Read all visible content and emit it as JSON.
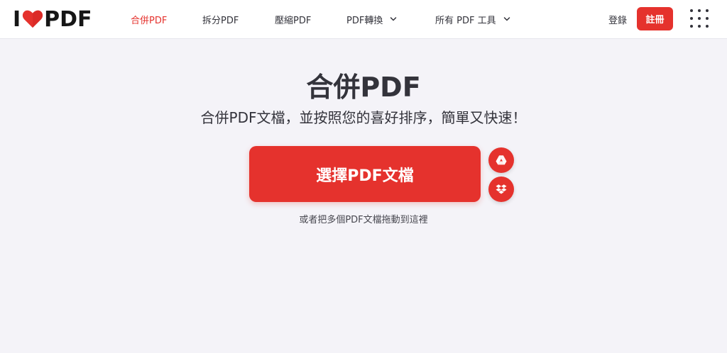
{
  "logo": {
    "text_left": "I",
    "text_right": "PDF",
    "heart_color": "#e5322d"
  },
  "nav": {
    "items": [
      {
        "label": "合併PDF",
        "active": true
      },
      {
        "label": "拆分PDF"
      },
      {
        "label": "壓縮PDF"
      },
      {
        "label": "PDF轉換",
        "dropdown": true
      },
      {
        "label": "所有 PDF 工具",
        "dropdown": true
      }
    ]
  },
  "account": {
    "login_label": "登錄",
    "signup_label": "註冊"
  },
  "main": {
    "title": "合併PDF",
    "subtitle": "合併PDF文檔，並按照您的喜好排序，簡單又快速！",
    "select_label": "選擇PDF文檔",
    "drop_hint": "或者把多個PDF文檔拖動到這裡"
  },
  "icons": {
    "cloud_1": "google-drive-icon",
    "cloud_2": "dropbox-icon",
    "apps": "grid-menu-icon"
  },
  "colors": {
    "accent": "#e5322d",
    "background": "#f4f3f8",
    "text": "#33333b"
  }
}
